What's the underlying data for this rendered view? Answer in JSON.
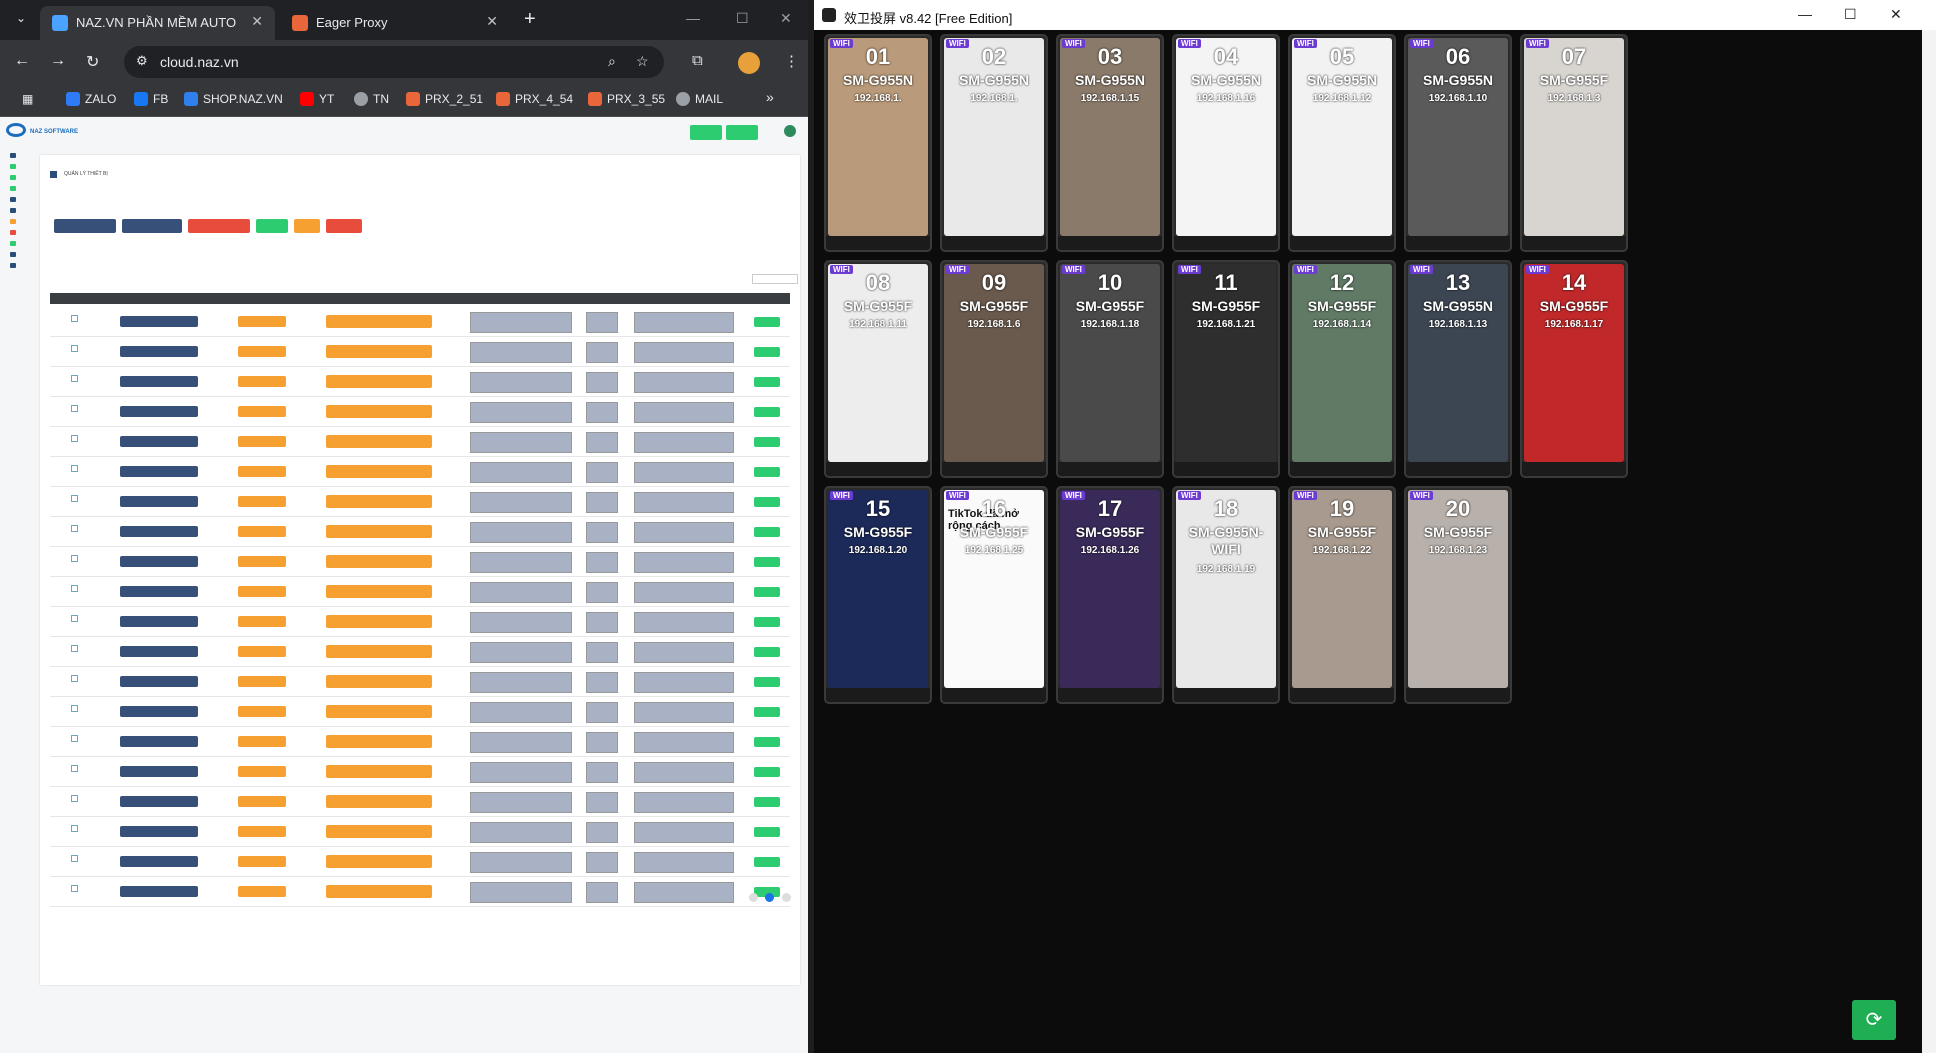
{
  "browser": {
    "tabs": [
      {
        "title": "NAZ.VN PHẦN MỀM AUTO NU",
        "active": true,
        "favicon_color": "#4aa3ff"
      },
      {
        "title": "Eager Proxy",
        "active": false,
        "favicon_color": "#e8663a"
      }
    ],
    "new_tab_label": "+",
    "url": "cloud.naz.vn",
    "bookmarks": [
      {
        "label": "ZALO",
        "color": "#2d7cf6"
      },
      {
        "label": "FB",
        "color": "#1877f2"
      },
      {
        "label": "SHOP.NAZ.VN",
        "color": "#2f80ed"
      },
      {
        "label": "YT",
        "color": "#ff0000"
      },
      {
        "label": "TN",
        "color": "#9aa0a6"
      },
      {
        "label": "PRX_2_51",
        "color": "#e8663a"
      },
      {
        "label": "PRX_4_54",
        "color": "#e8663a"
      },
      {
        "label": "PRX_3_55",
        "color": "#e8663a"
      },
      {
        "label": "MAIL",
        "color": "#9aa0a6"
      }
    ],
    "overflow_label": "»"
  },
  "site": {
    "brand": "NAZ SOFTWARE",
    "page_title": "QUẢN LÝ THIẾT BỊ",
    "row_count": 20
  },
  "mirror": {
    "title": "效卫投屏 v8.42 [Free Edition]",
    "devices": [
      {
        "num": "01",
        "model": "SM-G955N",
        "ip": "192.168.1.",
        "bg": "#b99a7a"
      },
      {
        "num": "02",
        "model": "SM-G955N",
        "ip": "192.168.1.",
        "bg": "#e9e9e9"
      },
      {
        "num": "03",
        "model": "SM-G955N",
        "ip": "192.168.1.15",
        "bg": "#8a7a6a"
      },
      {
        "num": "04",
        "model": "SM-G955N",
        "ip": "192.168.1.16",
        "bg": "#f4f4f4"
      },
      {
        "num": "05",
        "model": "SM-G955N",
        "ip": "192.168.1.12",
        "bg": "#f2f2f2"
      },
      {
        "num": "06",
        "model": "SM-G955N",
        "ip": "192.168.1.10",
        "bg": "#5a5a5a"
      },
      {
        "num": "07",
        "model": "SM-G955F",
        "ip": "192.168.1.3",
        "bg": "#d8d4d0"
      },
      {
        "num": "08",
        "model": "SM-G955F",
        "ip": "192.168.1.11",
        "bg": "#ededed"
      },
      {
        "num": "09",
        "model": "SM-G955F",
        "ip": "192.168.1.6",
        "bg": "#6a5a4e"
      },
      {
        "num": "10",
        "model": "SM-G955F",
        "ip": "192.168.1.18",
        "bg": "#4a4a4a"
      },
      {
        "num": "11",
        "model": "SM-G955F",
        "ip": "192.168.1.21",
        "bg": "#2e2e2e"
      },
      {
        "num": "12",
        "model": "SM-G955F",
        "ip": "192.168.1.14",
        "bg": "#607a66"
      },
      {
        "num": "13",
        "model": "SM-G955N",
        "ip": "192.168.1.13",
        "bg": "#3c4652"
      },
      {
        "num": "14",
        "model": "SM-G955F",
        "ip": "192.168.1.17",
        "bg": "#c0282a"
      },
      {
        "num": "15",
        "model": "SM-G955F",
        "ip": "192.168.1.20",
        "bg": "#1c2a5a"
      },
      {
        "num": "16",
        "model": "SM-G955F",
        "ip": "192.168.1.25",
        "bg": "#fafafa",
        "extra": "TikTok đã mở rộng cách"
      },
      {
        "num": "17",
        "model": "SM-G955F",
        "ip": "192.168.1.26",
        "bg": "#3a2a5a"
      },
      {
        "num": "18",
        "model": "SM-G955N-WIFI",
        "ip": "192.168.1.19",
        "bg": "#e8e8e8"
      },
      {
        "num": "19",
        "model": "SM-G955F",
        "ip": "192.168.1.22",
        "bg": "#a89a8e"
      },
      {
        "num": "20",
        "model": "SM-G955F",
        "ip": "192.168.1.23",
        "bg": "#b8b0aa"
      }
    ],
    "wifi_badge": "WIFI"
  }
}
